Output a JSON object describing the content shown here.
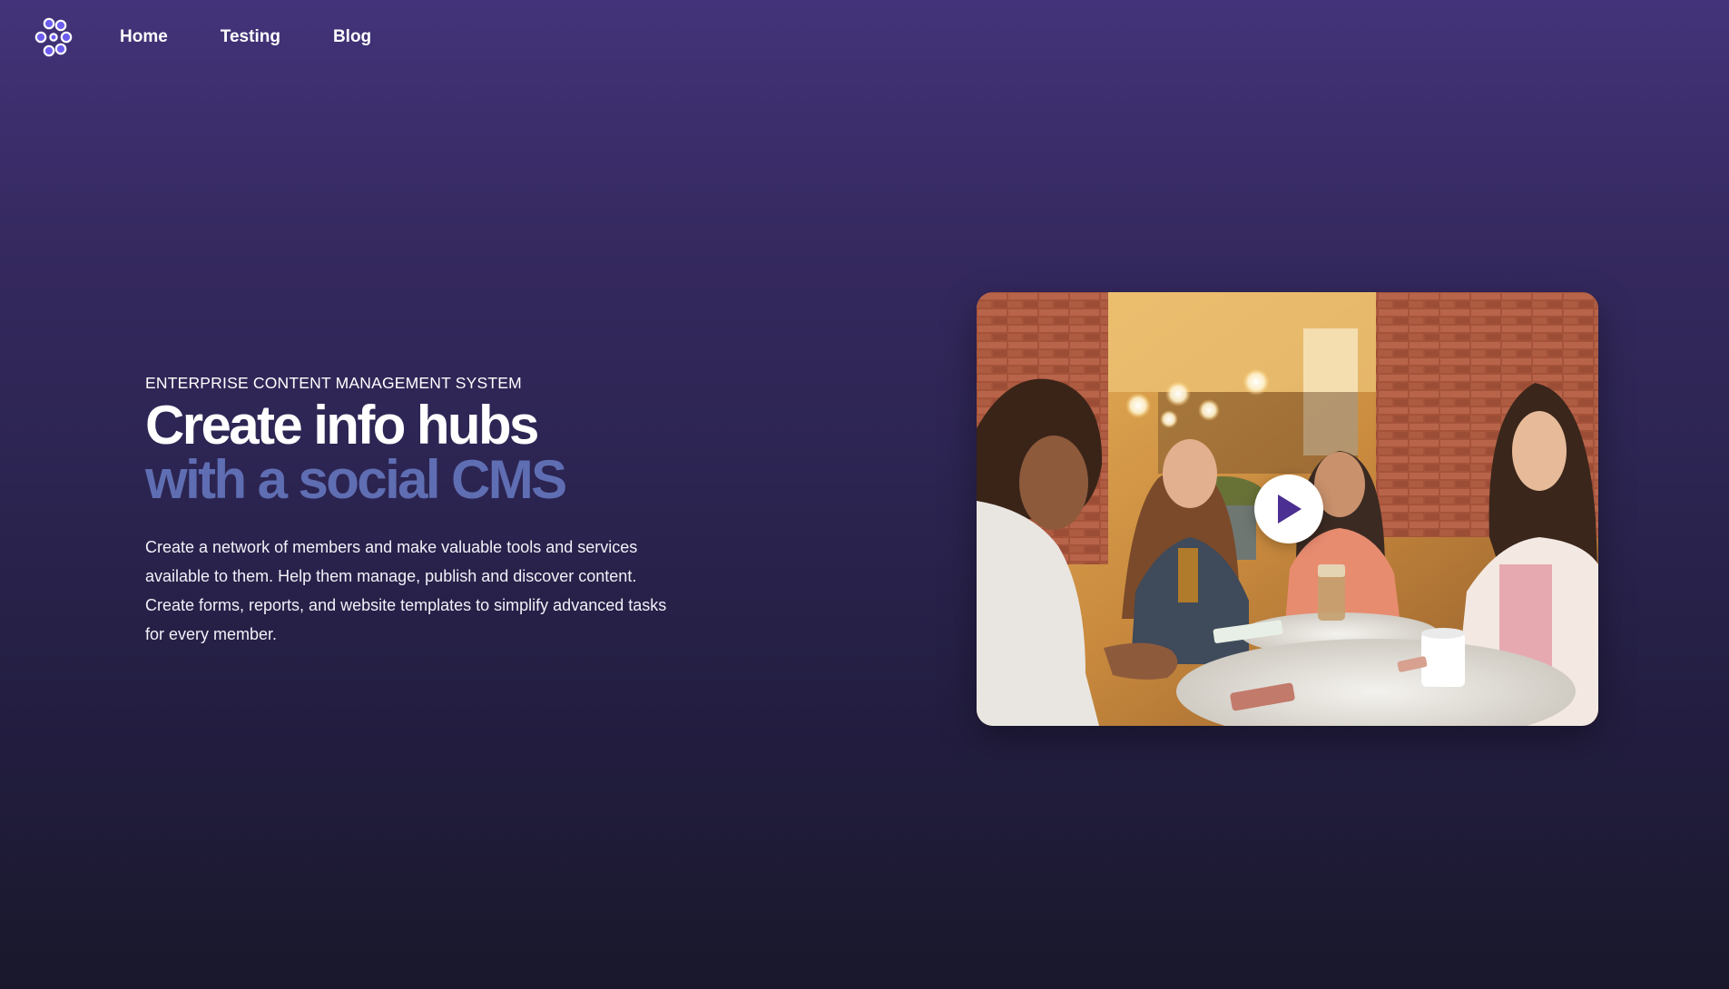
{
  "nav": {
    "logo_icon": "molecule-logo-icon",
    "items": [
      {
        "label": "Home"
      },
      {
        "label": "Testing"
      },
      {
        "label": "Blog"
      }
    ]
  },
  "hero": {
    "eyebrow": "ENTERPRISE CONTENT MANAGEMENT SYSTEM",
    "headline_line1": "Create info hubs",
    "headline_line2": "with a social CMS",
    "description": "Create a network of members and make valuable tools and services available to them. Help them manage, publish and discover content. Create forms, reports, and website templates to simplify advanced tasks for every member."
  },
  "media": {
    "image_icon": "cafe-meeting-photo",
    "play_icon": "play-icon"
  },
  "colors": {
    "background_top": "#43337a",
    "background_bottom": "#19182b",
    "headline_accent": "#5f6eb3",
    "logo_accent": "#6d5cf0",
    "play_accent": "#4b2f92"
  }
}
